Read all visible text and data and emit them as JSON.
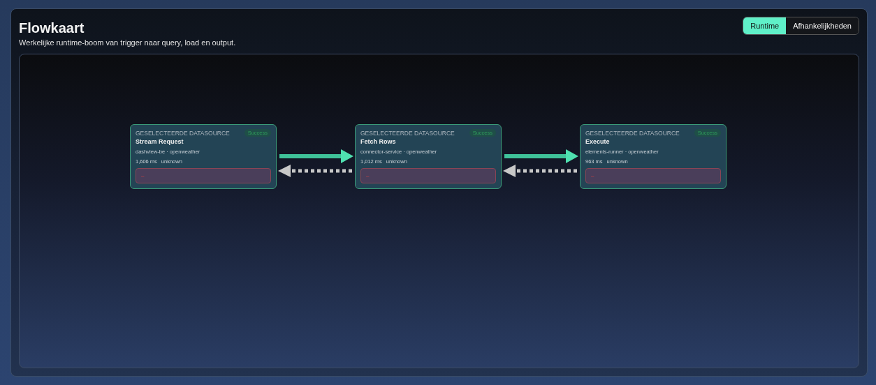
{
  "header": {
    "title": "Flowkaart",
    "subtitle": "Werkelijke runtime-boom van trigger naar query, load en output."
  },
  "view_tabs": [
    {
      "label": "Runtime",
      "selected": true
    },
    {
      "label": "Afhankelijkheden",
      "selected": false
    }
  ],
  "nodes": [
    {
      "category": "GESELECTEERDE DATASOURCE",
      "title": "Stream Request",
      "service": "dashview-be · openweather",
      "duration": "1,606 ms",
      "status": "unknown",
      "badge": "Success",
      "error": "–"
    },
    {
      "category": "GESELECTEERDE DATASOURCE",
      "title": "Fetch Rows",
      "service": "connector-service · openweather",
      "duration": "1,012 ms",
      "status": "unknown",
      "badge": "Success",
      "error": "–"
    },
    {
      "category": "GESELECTEERDE DATASOURCE",
      "title": "Execute",
      "service": "elements-runner · openweather",
      "duration": "963 ms",
      "status": "unknown",
      "badge": "Success",
      "error": "–"
    }
  ]
}
